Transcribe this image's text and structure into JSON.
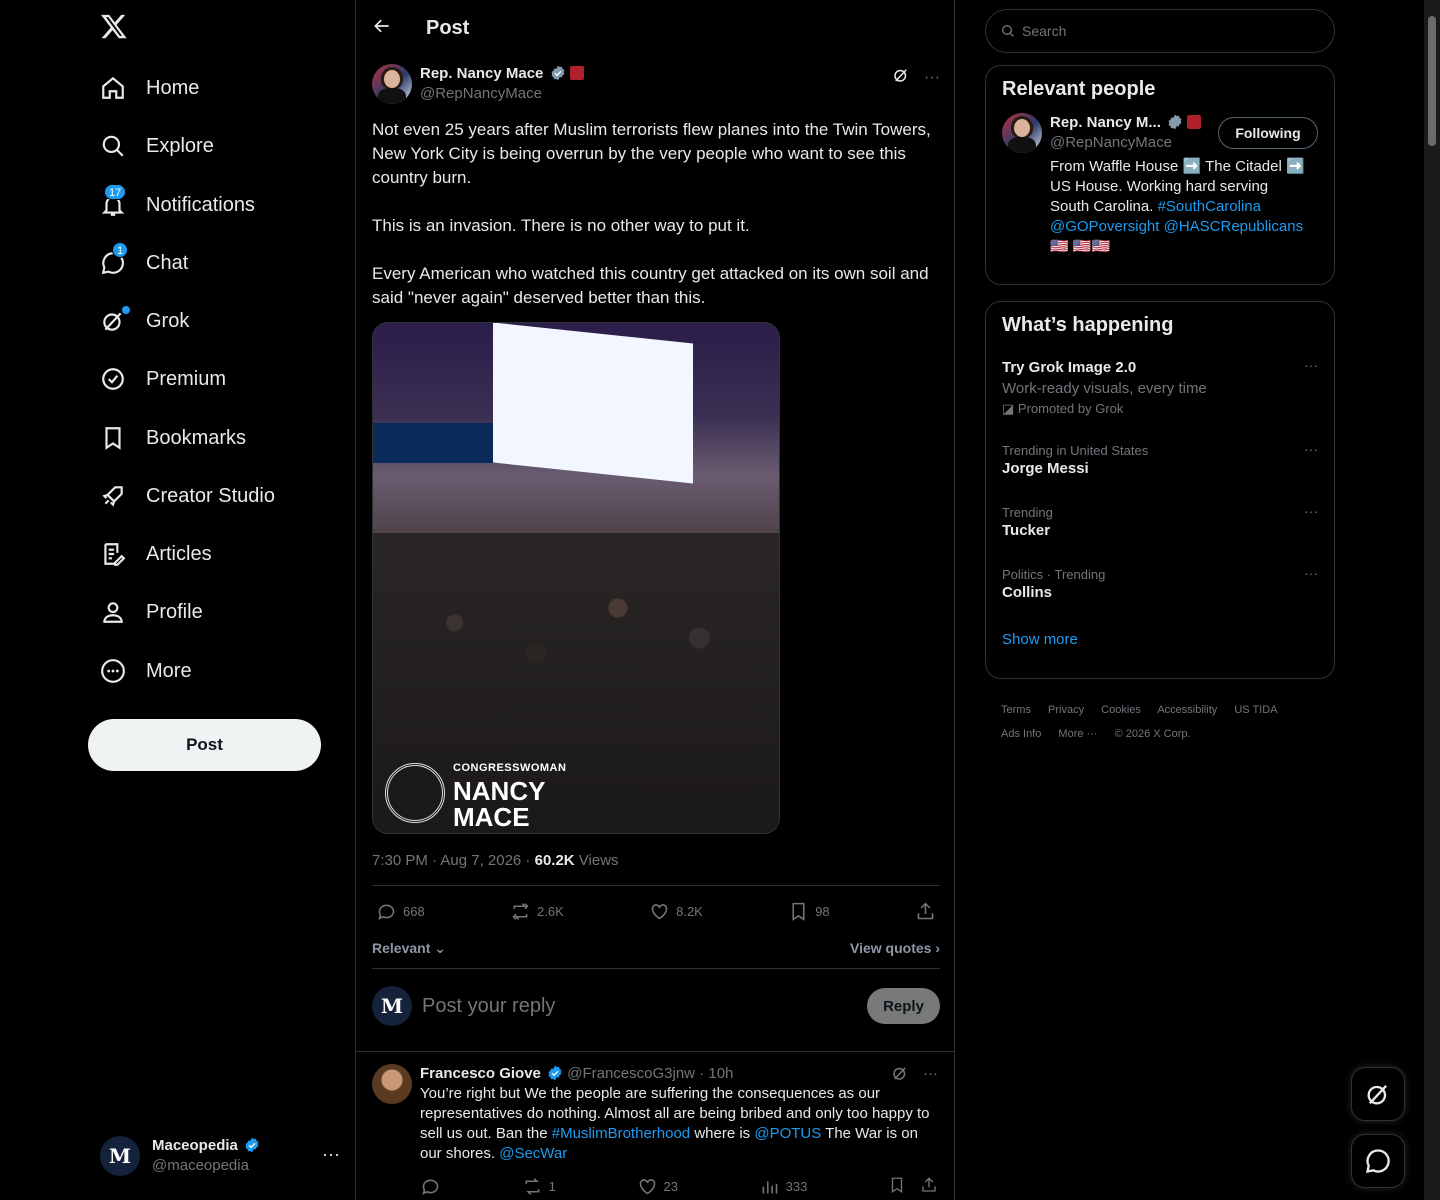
{
  "nav": {
    "items": [
      {
        "label": "Home",
        "icon": "home-icon"
      },
      {
        "label": "Explore",
        "icon": "search-icon"
      },
      {
        "label": "Notifications",
        "icon": "bell-icon",
        "badge": "17"
      },
      {
        "label": "Chat",
        "icon": "chat-icon",
        "badge": "1"
      },
      {
        "label": "Grok",
        "icon": "grok-icon"
      },
      {
        "label": "Premium",
        "icon": "premium-icon"
      },
      {
        "label": "Bookmarks",
        "icon": "bookmark-icon"
      },
      {
        "label": "Creator Studio",
        "icon": "rocket-icon"
      },
      {
        "label": "Articles",
        "icon": "articles-icon"
      },
      {
        "label": "Profile",
        "icon": "person-icon"
      },
      {
        "label": "More",
        "icon": "more-circle-icon"
      }
    ],
    "post_label": "Post",
    "account": {
      "name": "Maceopedia",
      "handle": "@maceopedia",
      "avatar_letter": "M"
    }
  },
  "header": {
    "title": "Post"
  },
  "tweet": {
    "author": "Rep. Nancy Mace",
    "handle": "@RepNancyMace",
    "text": "Not even 25 years after Muslim terrorists flew planes into the Twin Towers, New York City is being overrun by the very people who want to see this country burn.\n\nThis is an invasion. There is no other way to put it.\n\nEvery American who watched this country get attacked on its own soil and said \"never again\" deserved better than this.",
    "image_caption_small": "CONGRESSWOMAN",
    "image_caption_name1": "NANCY",
    "image_caption_name2": "MACE",
    "time": "7:30 PM · Aug 7, 2026 · ",
    "views_count": "60.2K",
    "views_label": " Views",
    "replies": "668",
    "reposts": "2.6K",
    "likes": "8.2K",
    "bookmarks": "98",
    "sort_label": "Relevant",
    "view_quotes": "View quotes"
  },
  "reply": {
    "placeholder": "Post your reply",
    "button": "Reply"
  },
  "comment": {
    "name": "Francesco Giove",
    "handle": "@FrancescoG3jnw",
    "time": "· 10h",
    "text_1": "You’re right but We the people are suffering the consequences as our representatives do nothing. Almost all are being bribed and only too happy to sell us out. Ban the ",
    "tag_1": "#MuslimBrotherhood",
    "text_2": " where is ",
    "tag_2": "@POTUS",
    "text_3": " The War is on our shores. ",
    "tag_3": "@SecWar",
    "reposts": "1",
    "likes": "23",
    "views": "333"
  },
  "right": {
    "search_placeholder": "Search",
    "relevant_title": "Relevant people",
    "person": {
      "name": "Rep. Nancy M...",
      "handle": "@RepNancyMace",
      "follow_label": "Following",
      "bio_1": "From Waffle House ➡️ The Citadel ➡️ US House. Working hard serving South Carolina. ",
      "bio_tag1": "#SouthCarolina",
      "bio_tag2": "@GOPoversight",
      "bio_tag3": "@HASCRepublicans",
      "bio_flags": " 🇺🇸 🇺🇸🇺🇸"
    },
    "happening_title": "What’s happening",
    "promo": {
      "title": "Try Grok Image 2.0",
      "sub": "Work-ready visuals, every time",
      "by": "Promoted by Grok"
    },
    "trends": [
      {
        "cat": "Trending in United States",
        "name": "Jorge Messi"
      },
      {
        "cat": "Trending",
        "name": "Tucker"
      },
      {
        "cat": "Politics · Trending",
        "name": "Collins"
      }
    ],
    "show_more": "Show more",
    "footer": [
      "Terms",
      "Privacy",
      "Cookies",
      "Accessibility",
      "US TIDA",
      "Ads Info",
      "More ···",
      "© 2026 X Corp."
    ]
  }
}
